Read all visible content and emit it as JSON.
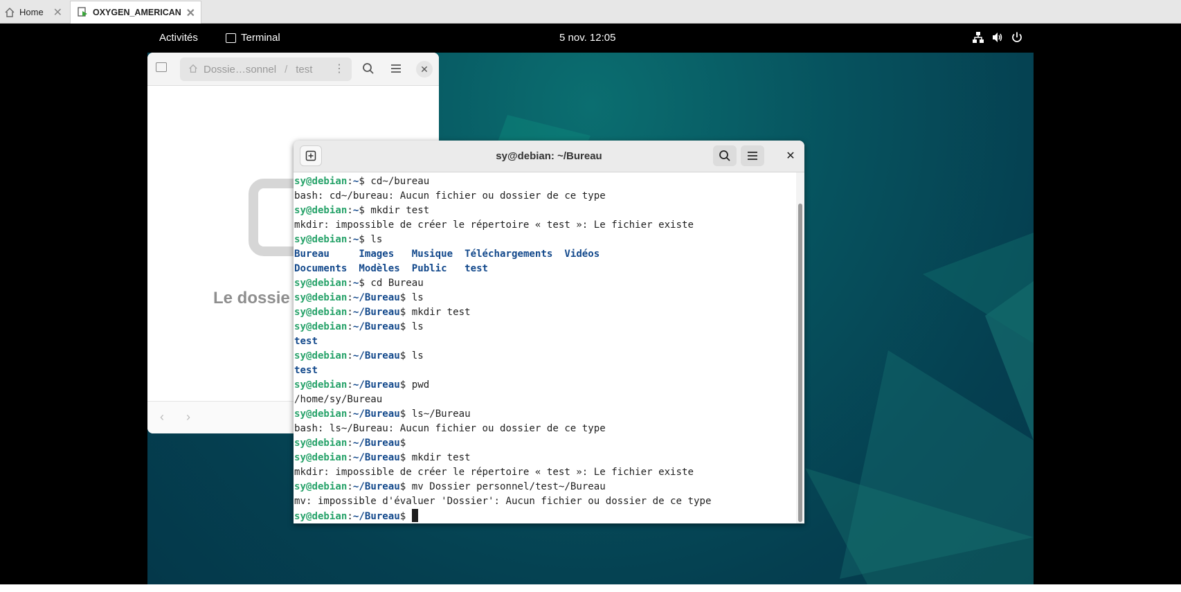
{
  "host_tabs": [
    {
      "label": "Home",
      "icon": "home-icon"
    },
    {
      "label": "OXYGEN_AMERICAN",
      "icon": "vm-icon"
    }
  ],
  "topbar": {
    "activities": "Activités",
    "app_name": "Terminal",
    "clock": "5 nov.  12:05",
    "icons": [
      "network-icon",
      "volume-icon",
      "power-icon"
    ]
  },
  "files": {
    "path_parent": "Dossie…sonnel",
    "path_sep": "/",
    "path_current": "test",
    "empty_text": "Le dossie"
  },
  "terminal": {
    "title": "sy@debian: ~/Bureau",
    "lines": [
      {
        "user": "sy@debian",
        "path": "~",
        "cmd": "cd~/bureau"
      },
      {
        "out": "bash: cd~/bureau: Aucun fichier ou dossier de ce type"
      },
      {
        "user": "sy@debian",
        "path": "~",
        "cmd": "mkdir test"
      },
      {
        "out": "mkdir: impossible de créer le répertoire « test »: Le fichier existe"
      },
      {
        "user": "sy@debian",
        "path": "~",
        "cmd": "ls"
      },
      {
        "dirs": [
          "Bureau     ",
          "Images   ",
          "Musique  ",
          "Téléchargements  ",
          "Vidéos"
        ]
      },
      {
        "dirs": [
          "Documents  ",
          "Modèles  ",
          "Public   ",
          "test"
        ]
      },
      {
        "user": "sy@debian",
        "path": "~",
        "cmd": "cd Bureau"
      },
      {
        "user": "sy@debian",
        "path": "~/Bureau",
        "cmd": "ls"
      },
      {
        "user": "sy@debian",
        "path": "~/Bureau",
        "cmd": "mkdir test"
      },
      {
        "user": "sy@debian",
        "path": "~/Bureau",
        "cmd": "ls"
      },
      {
        "dirs": [
          "test"
        ]
      },
      {
        "user": "sy@debian",
        "path": "~/Bureau",
        "cmd": "ls"
      },
      {
        "dirs": [
          "test"
        ]
      },
      {
        "user": "sy@debian",
        "path": "~/Bureau",
        "cmd": "pwd"
      },
      {
        "out": "/home/sy/Bureau"
      },
      {
        "user": "sy@debian",
        "path": "~/Bureau",
        "cmd": "ls~/Bureau"
      },
      {
        "out": "bash: ls~/Bureau: Aucun fichier ou dossier de ce type"
      },
      {
        "user": "sy@debian",
        "path": "~/Bureau",
        "cmd": ""
      },
      {
        "user": "sy@debian",
        "path": "~/Bureau",
        "cmd": "mkdir test"
      },
      {
        "out": "mkdir: impossible de créer le répertoire « test »: Le fichier existe"
      },
      {
        "user": "sy@debian",
        "path": "~/Bureau",
        "cmd": "mv Dossier personnel/test~/Bureau"
      },
      {
        "out": "mv: impossible d'évaluer 'Dossier': Aucun fichier ou dossier de ce type"
      },
      {
        "user": "sy@debian",
        "path": "~/Bureau",
        "cmd": "",
        "cursor": true
      }
    ]
  }
}
